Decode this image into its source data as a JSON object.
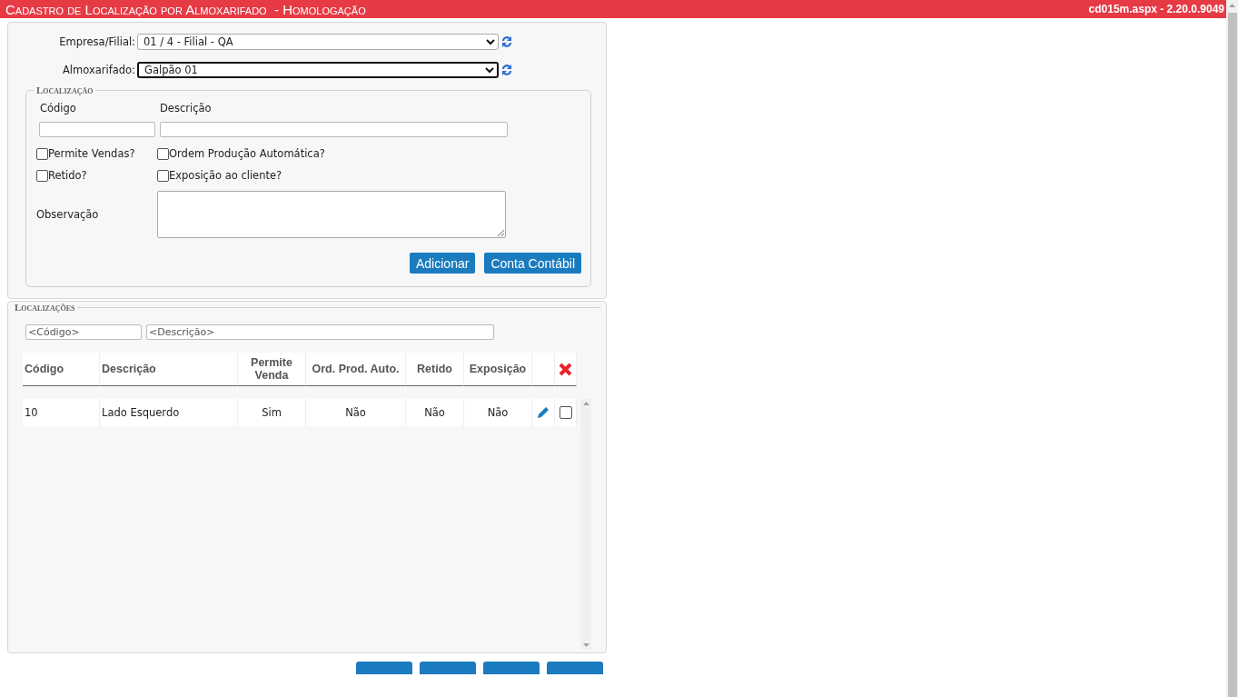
{
  "title_bar": {
    "title": "Cadastro de Localização por Almoxarifado  - Homologação",
    "version": "cd015m.aspx - 2.20.0.9049"
  },
  "selectors": [
    {
      "label": "Empresa/Filial:",
      "value": "01 / 4 - Filial - QA",
      "focused": false
    },
    {
      "label": "Almoxarifado:",
      "value": "Galpão 01",
      "focused": true
    }
  ],
  "localizacao": {
    "legend": "Localização",
    "code_label": "Código",
    "description_label": "Descrição",
    "checkboxes": [
      {
        "label": "Permite Vendas?",
        "checked": false
      },
      {
        "label": "Ordem Produção Automática?",
        "checked": false
      },
      {
        "label": "Retido?",
        "checked": false
      },
      {
        "label": "Exposição ao cliente?",
        "checked": false
      }
    ],
    "observation_label": "Observação",
    "buttons": [
      "Adicionar",
      "Conta Contábil"
    ]
  },
  "localizacoes": {
    "legend": "Localizações",
    "filters": [
      {
        "placeholder": "<Código>"
      },
      {
        "placeholder": "<Descrição>"
      }
    ],
    "columns": [
      "Código",
      "Descrição",
      "Permite Venda",
      "Ord. Prod. Auto.",
      "Retido",
      "Exposição"
    ],
    "rows": [
      {
        "cells": [
          "10",
          "Lado Esquerdo",
          "Sim",
          "Não",
          "Não",
          "Não"
        ],
        "checked": false
      }
    ]
  },
  "footer_buttons": [
    {
      "kind": "button"
    },
    {
      "kind": "button"
    },
    {
      "kind": "button"
    },
    {
      "kind": "button"
    }
  ]
}
